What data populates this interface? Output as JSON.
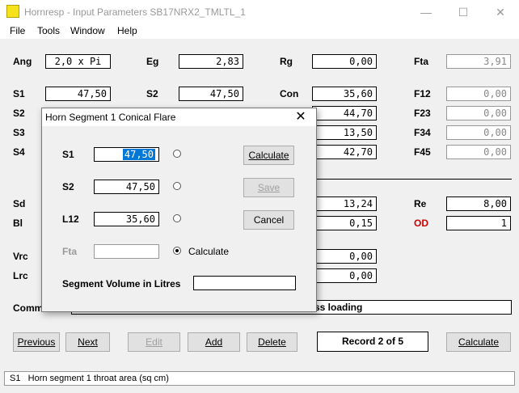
{
  "window": {
    "title": "Hornresp - Input Parameters   SB17NRX2_TMLTL_1",
    "minimize": "—",
    "maximize": "☐",
    "close": "✕"
  },
  "menu": [
    "File",
    "Tools",
    "Window",
    "Help"
  ],
  "params": {
    "ang_label": "Ang",
    "ang": "2,0 x Pi",
    "eg_label": "Eg",
    "eg": "2,83",
    "rg_label": "Rg",
    "rg": "0,00",
    "fta_label": "Fta",
    "fta": "3,91",
    "s1_label": "S1",
    "s1": "47,50",
    "s2_label": "S2",
    "s2": "47,50",
    "con_label": "Con",
    "con": "35,60",
    "f12_label": "F12",
    "f12": "0,00",
    "s2b_label": "S2",
    "row2_value": "44,70",
    "f23_label": "F23",
    "f23": "0,00",
    "s3_label": "S3",
    "row3_value": "13,50",
    "f34_label": "F34",
    "f34": "0,00",
    "s4_label": "S4",
    "row4_value": "42,70",
    "f45_label": "F45",
    "f45": "0,00",
    "sd_label": "Sd",
    "sd_row_value": "13,24",
    "re_label": "Re",
    "re": "8,00",
    "bl_label": "Bl",
    "bl_row_value": "0,15",
    "od_label": "OD",
    "od": "1",
    "vrc_label": "Vrc",
    "vrc_row_value": "0,00",
    "lrc_label": "Lrc",
    "lrc_row_value": "0,00",
    "comment_label": "Comm",
    "comment_value": "ss loading"
  },
  "buttons": {
    "previous": "Previous",
    "next": "Next",
    "edit": "Edit",
    "add": "Add",
    "delete": "Delete",
    "record": "Record 2 of 5",
    "calculate": "Calculate"
  },
  "status": {
    "field": "S1",
    "text": "Horn segment 1 throat area  (sq cm)"
  },
  "dialog": {
    "title": "Horn Segment 1 Conical Flare",
    "close": "✕",
    "s1_label": "S1",
    "s1": "47,50",
    "s2_label": "S2",
    "s2": "47,50",
    "l12_label": "L12",
    "l12": "35,60",
    "fta_label": "Fta",
    "fta": "",
    "calc_radio_label": "Calculate",
    "calculate_btn": "Calculate",
    "save_btn": "Save",
    "cancel_btn": "Cancel",
    "volume_label": "Segment Volume in Litres",
    "volume": ""
  }
}
